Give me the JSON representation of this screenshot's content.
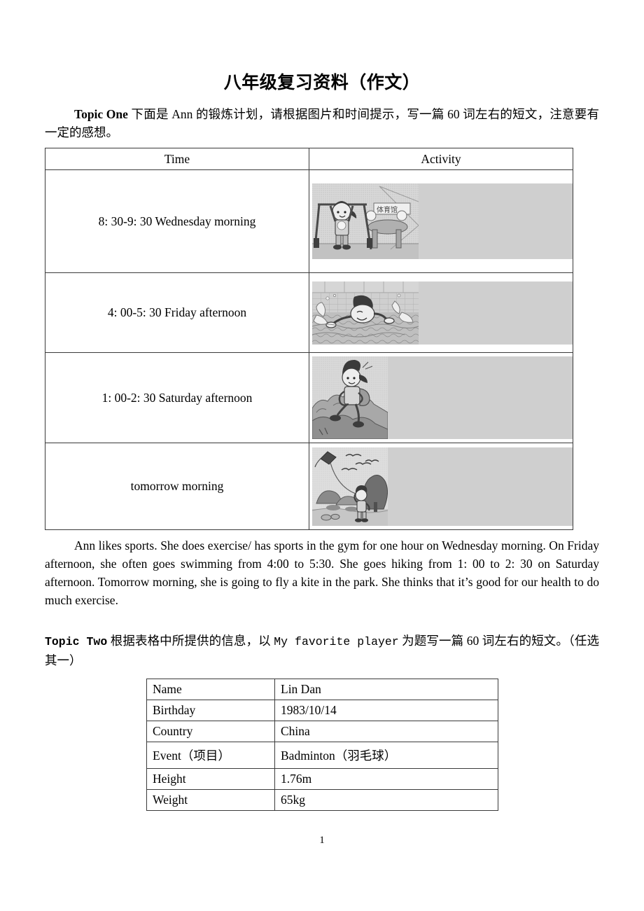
{
  "document": {
    "title": "八年级复习资料（作文）",
    "page_number": "1"
  },
  "topic_one": {
    "label": "Topic One",
    "prompt": " 下面是 Ann 的锻炼计划，请根据图片和时间提示，写一篇 60 词左右的短文，注意要有一定的感想。"
  },
  "schedule_table": {
    "headers": [
      "Time",
      "Activity"
    ],
    "rows": [
      {
        "time": "8: 30-9: 30 Wednesday morning",
        "activity_icon": "gym-horizontal-bar-illustration"
      },
      {
        "time": "4: 00-5: 30 Friday afternoon",
        "activity_icon": "swimming-illustration"
      },
      {
        "time": "1: 00-2: 30 Saturday afternoon",
        "activity_icon": "hiking-illustration"
      },
      {
        "time": "tomorrow morning",
        "activity_icon": "kite-flying-illustration"
      }
    ]
  },
  "sample_essay": {
    "text": "Ann likes sports. She does exercise/ has sports in the gym for one hour on Wednesday morning. On Friday afternoon, she often goes swimming from 4:00 to 5:30. She goes hiking from 1: 00 to 2: 30 on Saturday afternoon. Tomorrow morning, she is going to fly a kite in the park. She thinks that it’s good for our health to do much exercise."
  },
  "topic_two": {
    "label": "Topic Two",
    "prompt_before": " 根据表格中所提供的信息，以 ",
    "title_quoted": "My favorite player",
    "prompt_after": " 为题写一篇 60 词左右的短文。（任选其一）"
  },
  "player_table": {
    "rows": [
      {
        "label": "Name",
        "value": "Lin Dan"
      },
      {
        "label": "Birthday",
        "value": "1983/10/14"
      },
      {
        "label": "Country",
        "value": "China"
      },
      {
        "label": "Event（项目）",
        "value": "Badminton（羽毛球）"
      },
      {
        "label": "Height",
        "value": "1.76m"
      },
      {
        "label": "Weight",
        "value": "65kg"
      }
    ]
  },
  "colors": {
    "text": "#000000",
    "border": "#3a3a3a",
    "illustration_base": "#cfcfcf"
  }
}
